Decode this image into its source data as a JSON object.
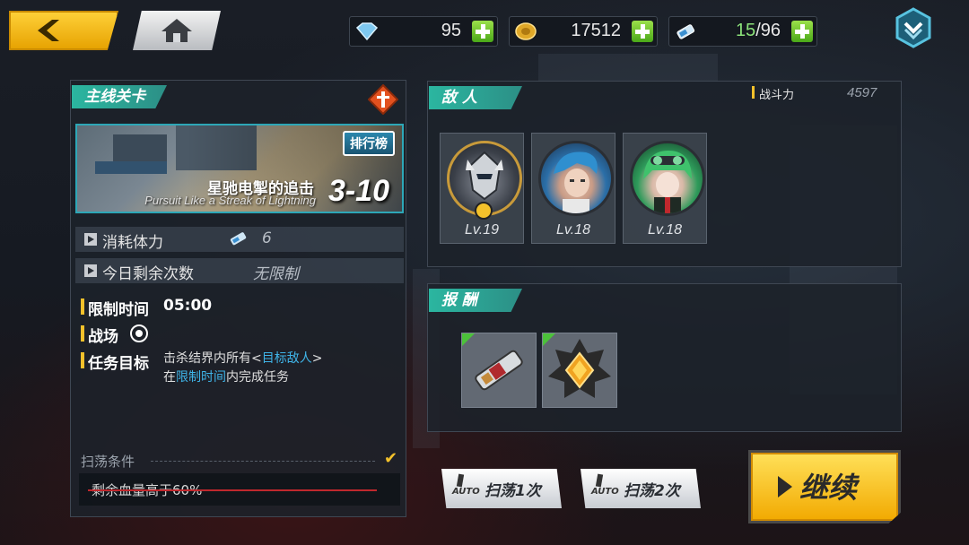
{
  "resources": {
    "gems": "95",
    "gold": "17512",
    "stamina": "15/96",
    "stamina_current": "15",
    "stamina_max": "/96"
  },
  "stage": {
    "section_title": "主线关卡",
    "ranking_label": "排行榜",
    "name": "星驰电掣的追击",
    "subtitle": "Pursuit Like a Streak of Lightning",
    "number": "3-10",
    "stamina_cost_label": "消耗体力",
    "stamina_cost_value": "6",
    "daily_remaining_label": "今日剩余次数",
    "daily_remaining_value": "无限制",
    "time_limit_label": "限制时间",
    "time_limit_value": "05:00",
    "battlefield_label": "战场",
    "objective_label": "任务目标",
    "objective_line1_prefix": "击杀结界内所有<",
    "objective_line1_highlight": "目标敌人",
    "objective_line1_suffix": ">",
    "objective_line2_prefix": "在",
    "objective_line2_highlight": "限制时间",
    "objective_line2_suffix": "内完成任务",
    "sweep_condition_title": "扫荡条件",
    "sweep_condition": "剩余血量高于60%"
  },
  "enemies": {
    "title": "敌 人",
    "power_label": "战斗力",
    "power_value": "4597",
    "list": [
      {
        "level": "Lv.19"
      },
      {
        "level": "Lv.18"
      },
      {
        "level": "Lv.18"
      }
    ]
  },
  "rewards": {
    "title": "报 酬"
  },
  "buttons": {
    "sweep1": "扫荡1次",
    "sweep2": "扫荡2次",
    "auto": "AUTO",
    "continue": "继续"
  },
  "colors": {
    "accent_teal": "#2bb6a0",
    "gold": "#f3c12b",
    "highlight_blue": "#3fb4e8"
  }
}
